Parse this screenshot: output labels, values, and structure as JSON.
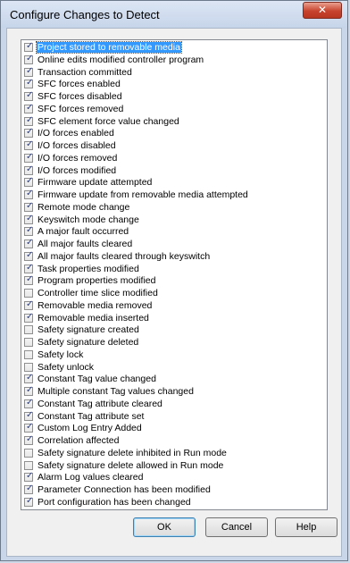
{
  "window": {
    "title": "Configure Changes to Detect"
  },
  "items": [
    {
      "label": "Project stored to removable media",
      "checked": true,
      "selected": true
    },
    {
      "label": "Online edits modified controller program",
      "checked": true
    },
    {
      "label": "Transaction committed",
      "checked": true
    },
    {
      "label": "SFC forces enabled",
      "checked": true
    },
    {
      "label": "SFC forces disabled",
      "checked": true
    },
    {
      "label": "SFC forces removed",
      "checked": true
    },
    {
      "label": "SFC element force value changed",
      "checked": true
    },
    {
      "label": "I/O forces enabled",
      "checked": true
    },
    {
      "label": "I/O forces disabled",
      "checked": true
    },
    {
      "label": "I/O forces removed",
      "checked": true
    },
    {
      "label": "I/O forces modified",
      "checked": true
    },
    {
      "label": "Firmware update attempted",
      "checked": true
    },
    {
      "label": "Firmware update from removable media attempted",
      "checked": true
    },
    {
      "label": "Remote mode change",
      "checked": true
    },
    {
      "label": "Keyswitch mode change",
      "checked": true
    },
    {
      "label": "A major fault occurred",
      "checked": true
    },
    {
      "label": "All major faults cleared",
      "checked": true
    },
    {
      "label": "All major faults cleared through keyswitch",
      "checked": true
    },
    {
      "label": "Task properties modified",
      "checked": true
    },
    {
      "label": "Program properties modified",
      "checked": true
    },
    {
      "label": "Controller time slice modified",
      "checked": false
    },
    {
      "label": "Removable media removed",
      "checked": true
    },
    {
      "label": "Removable media inserted",
      "checked": true
    },
    {
      "label": "Safety signature created",
      "checked": false
    },
    {
      "label": "Safety signature deleted",
      "checked": false
    },
    {
      "label": "Safety lock",
      "checked": false
    },
    {
      "label": "Safety unlock",
      "checked": false
    },
    {
      "label": "Constant Tag value changed",
      "checked": true
    },
    {
      "label": "Multiple constant Tag values changed",
      "checked": true
    },
    {
      "label": "Constant Tag attribute cleared",
      "checked": true
    },
    {
      "label": "Constant Tag attribute set",
      "checked": true
    },
    {
      "label": "Custom Log Entry Added",
      "checked": true
    },
    {
      "label": "Correlation affected",
      "checked": true
    },
    {
      "label": "Safety signature delete inhibited in Run mode",
      "checked": false
    },
    {
      "label": "Safety signature delete allowed in Run mode",
      "checked": false
    },
    {
      "label": "Alarm Log values cleared",
      "checked": true
    },
    {
      "label": "Parameter Connection has been modified",
      "checked": true
    },
    {
      "label": "Port configuration has been changed",
      "checked": true
    }
  ],
  "buttons": {
    "ok": "OK",
    "cancel": "Cancel",
    "help": "Help"
  },
  "icons": {
    "close": "close-icon",
    "check": "checkmark-icon"
  },
  "colors": {
    "selection": "#3399ff",
    "close_button": "#c8432d",
    "check": "#2a3e8a"
  }
}
